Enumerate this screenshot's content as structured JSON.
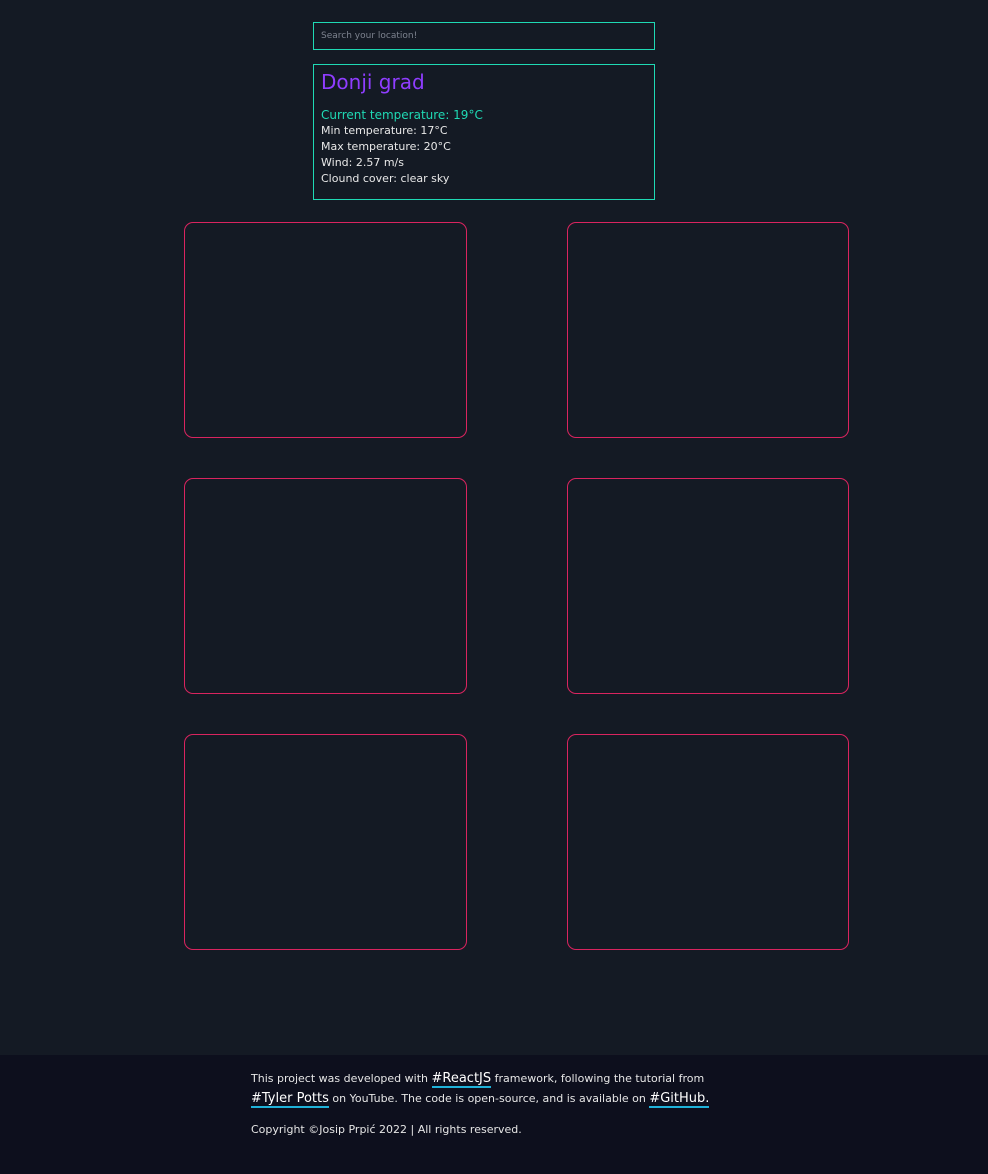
{
  "search": {
    "placeholder": "Search your location!"
  },
  "weather": {
    "city": "Donji grad",
    "current_temperature": "Current temperature: 19°C",
    "min_temperature": "Min temperature: 17°C",
    "max_temperature": "Max temperature: 20°C",
    "wind": "Wind: 2.57 m/s",
    "cloud_cover": "Clound cover: clear sky"
  },
  "footer": {
    "text_1": "This project was developed with",
    "link_reactjs": "#ReactJS",
    "text_2": "framework, following the tutorial from",
    "link_tyler": "#Tyler Potts",
    "text_3": "on YouTube. The code is open-source, and is available on",
    "link_github": "#GitHub.",
    "copyright": "Copyright ©Josip Prpić 2022 | All rights reserved."
  },
  "colors": {
    "background": "#141a24",
    "footer_background": "#0d0f1d",
    "accent_teal": "#1fd9b4",
    "city_purple": "#8f3dff",
    "card_border_pink": "#d9245f",
    "link_underline": "#1fb2d9"
  }
}
